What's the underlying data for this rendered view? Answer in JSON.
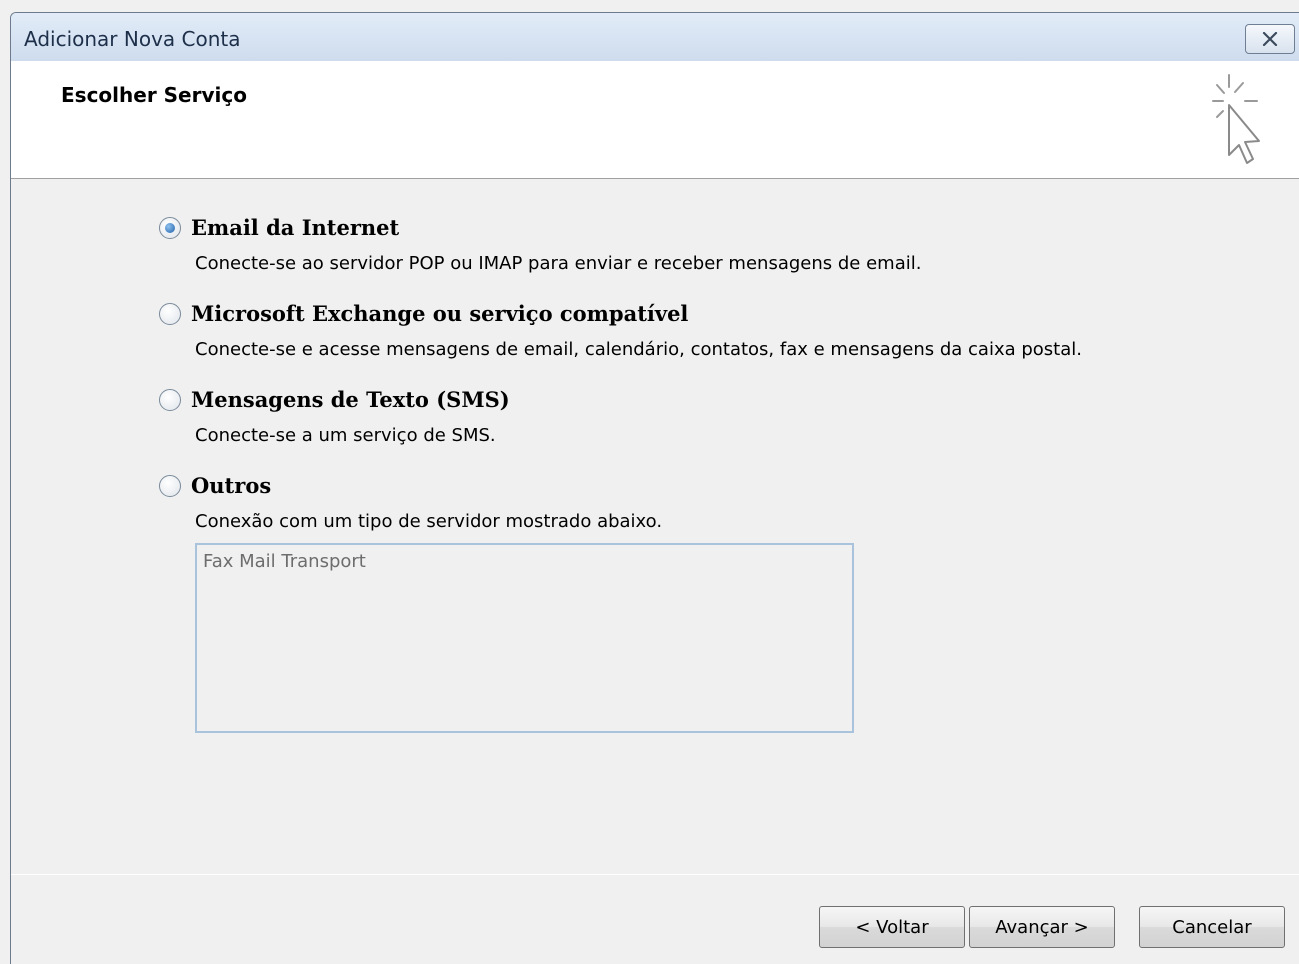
{
  "window": {
    "title": "Adicionar Nova Conta"
  },
  "header": {
    "title": "Escolher Serviço",
    "icon": "wizard-cursor-icon"
  },
  "options": [
    {
      "label": "Email da Internet",
      "description": "Conecte-se ao servidor POP ou IMAP para enviar e receber mensagens de email.",
      "checked": true
    },
    {
      "label": "Microsoft Exchange ou serviço compatível",
      "description": "Conecte-se e acesse mensagens de email, calendário, contatos, fax e mensagens da caixa postal.",
      "checked": false
    },
    {
      "label": "Mensagens de Texto (SMS)",
      "description": "Conecte-se a um serviço de SMS.",
      "checked": false
    },
    {
      "label": "Outros",
      "description": "Conexão com um tipo de servidor mostrado abaixo.",
      "checked": false
    }
  ],
  "server_list": {
    "items": [
      "Fax Mail Transport"
    ]
  },
  "buttons": {
    "back": "< Voltar",
    "next": "Avançar >",
    "cancel": "Cancelar"
  },
  "colors": {
    "radio_selected": "#1e5fa8",
    "listbox_border": "#a9c3dc"
  }
}
